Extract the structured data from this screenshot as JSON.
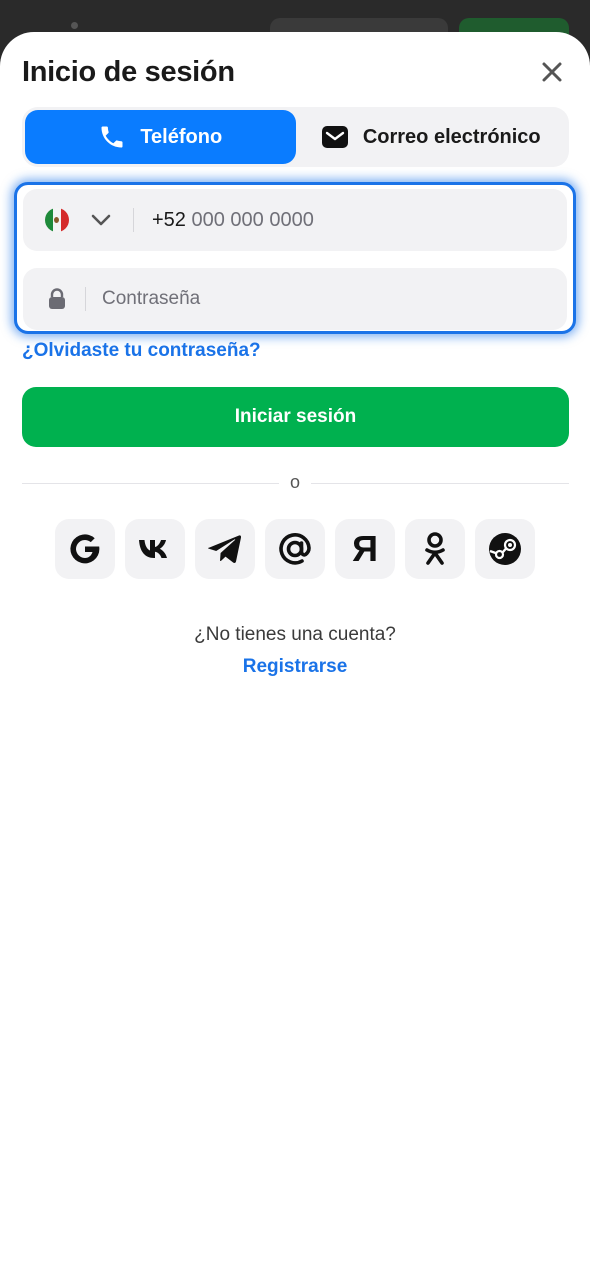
{
  "header": {
    "title": "Inicio de sesión",
    "close_icon": "close-icon"
  },
  "tabs": [
    {
      "label": "Teléfono",
      "icon": "phone-icon",
      "active": true
    },
    {
      "label": "Correo electrónico",
      "icon": "mail-icon",
      "active": false
    }
  ],
  "phone_field": {
    "country_icon": "mexico-flag-icon",
    "country_code": "+52",
    "placeholder": "000 000 0000"
  },
  "password_field": {
    "placeholder": "Contraseña",
    "icon": "lock-icon"
  },
  "forgot_password": "¿Olvidaste tu contraseña?",
  "login_button": "Iniciar sesión",
  "separator": "o",
  "social_logins": [
    {
      "name": "google-icon"
    },
    {
      "name": "vk-icon"
    },
    {
      "name": "telegram-icon"
    },
    {
      "name": "mail-ru-icon"
    },
    {
      "name": "yandex-icon",
      "glyph": "Я"
    },
    {
      "name": "odnoklassniki-icon"
    },
    {
      "name": "steam-icon"
    }
  ],
  "footer": {
    "no_account": "¿No tienes una cuenta?",
    "register": "Registrarse"
  },
  "colors": {
    "primary_blue": "#0a7cff",
    "link_blue": "#1a73e8",
    "green": "#00b14f",
    "field_bg": "#f2f2f4"
  }
}
